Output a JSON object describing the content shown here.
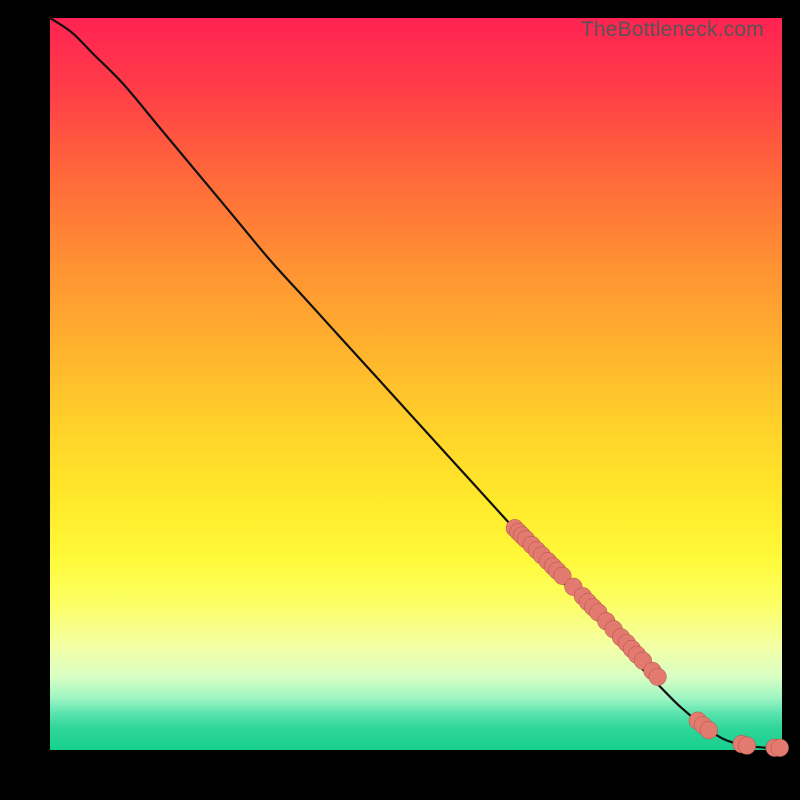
{
  "watermark": "TheBottleneck.com",
  "colors": {
    "dot_fill": "#e37a6f",
    "dot_stroke": "#ad4f47",
    "curve": "#111111",
    "frame_bg": "#000000"
  },
  "chart_data": {
    "type": "line",
    "title": "",
    "xlabel": "",
    "ylabel": "",
    "xlim": [
      0,
      100
    ],
    "ylim": [
      0,
      100
    ],
    "grid": false,
    "series": [
      {
        "name": "curve",
        "type": "line",
        "x": [
          0,
          3,
          6,
          10,
          15,
          20,
          25,
          30,
          35,
          40,
          45,
          50,
          55,
          60,
          65,
          70,
          75,
          80,
          83,
          86,
          89,
          92,
          95,
          98,
          100
        ],
        "y": [
          100,
          98,
          95,
          91,
          85,
          79,
          73,
          67,
          61.5,
          56,
          50.5,
          45,
          39.5,
          34,
          28.5,
          23,
          17.5,
          12,
          9,
          6,
          3.5,
          1.5,
          0.6,
          0.3,
          0.3
        ]
      },
      {
        "name": "points",
        "type": "scatter",
        "x": [
          63.5,
          64.0,
          64.5,
          65.0,
          65.8,
          66.5,
          67.2,
          68.0,
          68.7,
          69.3,
          70.0,
          71.5,
          72.8,
          73.5,
          74.2,
          74.9,
          76.0,
          77.0,
          78.0,
          78.8,
          79.5,
          80.2,
          81.0,
          82.3,
          83.0,
          88.5,
          89.2,
          90.0,
          94.5,
          95.2,
          99.0,
          99.7
        ],
        "y": [
          30.3,
          29.8,
          29.3,
          28.8,
          28.0,
          27.3,
          26.6,
          25.8,
          25.1,
          24.5,
          23.8,
          22.3,
          21.0,
          20.2,
          19.5,
          18.8,
          17.6,
          16.5,
          15.4,
          14.6,
          13.8,
          13.0,
          12.2,
          10.8,
          10.0,
          4.0,
          3.4,
          2.7,
          0.8,
          0.6,
          0.3,
          0.3
        ]
      }
    ]
  }
}
